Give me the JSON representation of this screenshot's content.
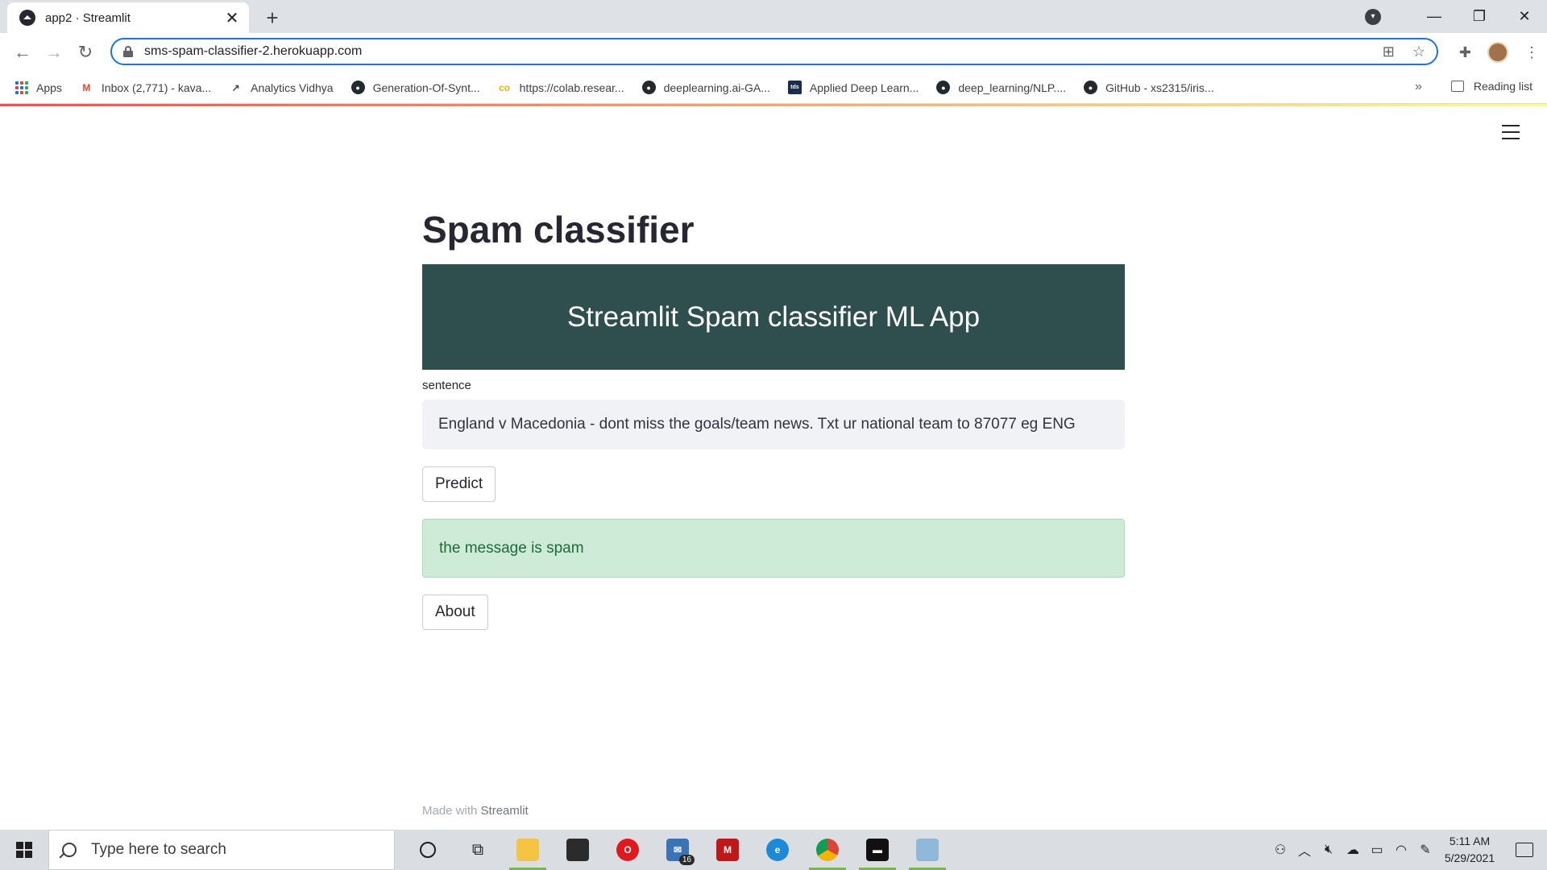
{
  "browser": {
    "tab_title": "app2 · Streamlit",
    "tab_close": "✕",
    "new_tab": "+",
    "url": "sms-spam-classifier-2.herokuapp.com",
    "bookmarks": [
      {
        "label": "Apps",
        "icon": "apps-grid-icon"
      },
      {
        "label": "Inbox (2,771) - kava...",
        "icon": "gmail-icon"
      },
      {
        "label": "Analytics Vidhya",
        "icon": "analytics-vidhya-icon"
      },
      {
        "label": "Generation-Of-Synt...",
        "icon": "github-icon"
      },
      {
        "label": "https://colab.resear...",
        "icon": "colab-icon"
      },
      {
        "label": "deeplearning.ai-GA...",
        "icon": "github-icon"
      },
      {
        "label": "Applied Deep Learn...",
        "icon": "tds-icon"
      },
      {
        "label": "deep_learning/NLP....",
        "icon": "github-icon"
      },
      {
        "label": "GitHub - xs2315/iris...",
        "icon": "github-icon"
      }
    ],
    "bookmarks_more": "»",
    "reading_list": "Reading list"
  },
  "app": {
    "title": "Spam classifier",
    "banner": "Streamlit Spam classifier ML App",
    "input_label": "sentence",
    "input_value": "England v Macedonia - dont miss the goals/team news. Txt ur national team to 87077 eg ENG",
    "predict_label": "Predict",
    "result": "the message is spam",
    "about_label": "About",
    "footer_prefix": "Made with",
    "footer_brand": "Streamlit"
  },
  "colors": {
    "banner_bg": "#2f4f4f",
    "success_bg": "#cdebd6",
    "success_text": "#1e6b3a",
    "accent": "#1a73e8"
  },
  "taskbar": {
    "search_placeholder": "Type here to search",
    "mail_badge": "16",
    "time": "5:11 AM",
    "date": "5/29/2021"
  }
}
